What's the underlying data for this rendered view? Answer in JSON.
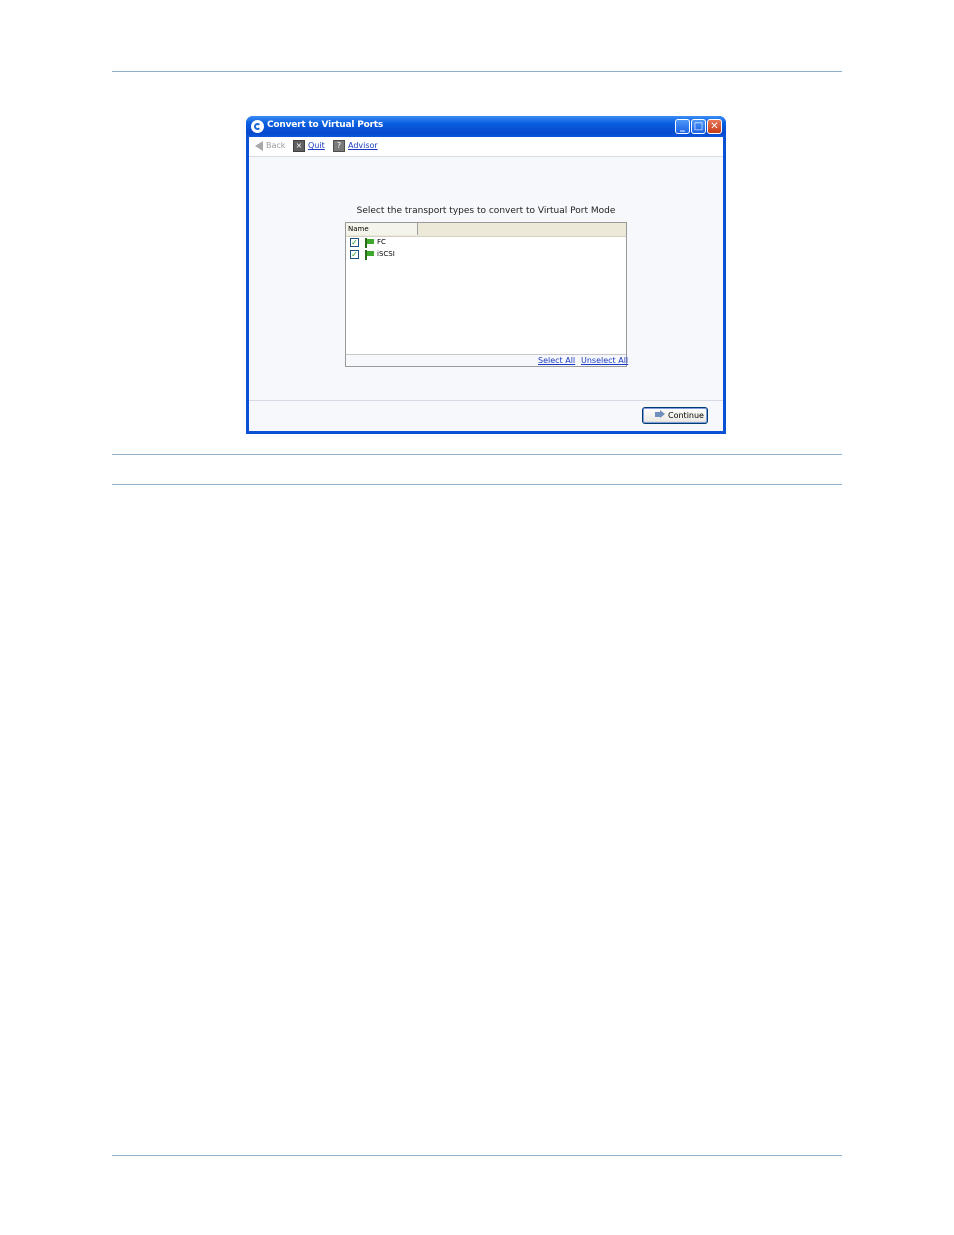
{
  "window": {
    "title": "Convert to Virtual Ports",
    "minimize_glyph": "_",
    "maximize_glyph": "□",
    "close_glyph": "✕"
  },
  "toolbar": {
    "back_label": "Back",
    "quit_label": "Quit",
    "advisor_label": "Advisor"
  },
  "prompt": "Select the transport types to convert to Virtual Port Mode",
  "list": {
    "column_header": "Name",
    "items": [
      {
        "label": "FC",
        "checked": true
      },
      {
        "label": "iSCSI",
        "checked": true
      }
    ],
    "select_all_label": "Select All",
    "unselect_all_label": "Unselect All"
  },
  "footer": {
    "continue_label": "Continue"
  },
  "icons": {
    "back": "back-arrow-icon",
    "quit": "quit-icon",
    "advisor": "advisor-icon",
    "item": "flag-icon",
    "continue": "arrow-right-icon"
  },
  "colors": {
    "titlebar": "#0a51d6",
    "link": "#1a38c2",
    "rule": "#8fb0c8",
    "flag": "#3ea82d"
  }
}
